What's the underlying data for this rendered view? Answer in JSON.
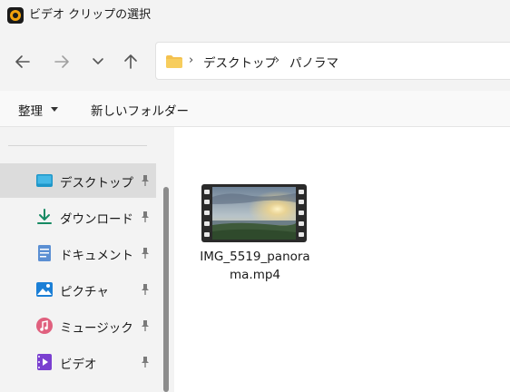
{
  "window": {
    "title": "ビデオ クリップの選択"
  },
  "nav": {
    "back_icon": "arrow-left-icon",
    "forward_icon": "arrow-right-icon",
    "history_icon": "chevron-down-icon",
    "up_icon": "arrow-up-icon"
  },
  "address": {
    "breadcrumbs": [
      "デスクトップ",
      "パノラマ"
    ]
  },
  "toolbar": {
    "organize_label": "整理",
    "new_folder_label": "新しいフォルダー"
  },
  "sidebar": {
    "items": [
      {
        "label": "デスクトップ",
        "icon": "desktop-icon",
        "selected": true
      },
      {
        "label": "ダウンロード",
        "icon": "download-icon",
        "selected": false
      },
      {
        "label": "ドキュメント",
        "icon": "document-icon",
        "selected": false
      },
      {
        "label": "ピクチャ",
        "icon": "pictures-icon",
        "selected": false
      },
      {
        "label": "ミュージック",
        "icon": "music-icon",
        "selected": false
      },
      {
        "label": "ビデオ",
        "icon": "video-icon",
        "selected": false
      }
    ]
  },
  "files": [
    {
      "name": "IMG_5519_panorama.mp4",
      "type": "video"
    }
  ],
  "colors": {
    "accent": "#0067c0",
    "folder": "#f4c14e",
    "selected_bg": "#dcdcdc"
  }
}
